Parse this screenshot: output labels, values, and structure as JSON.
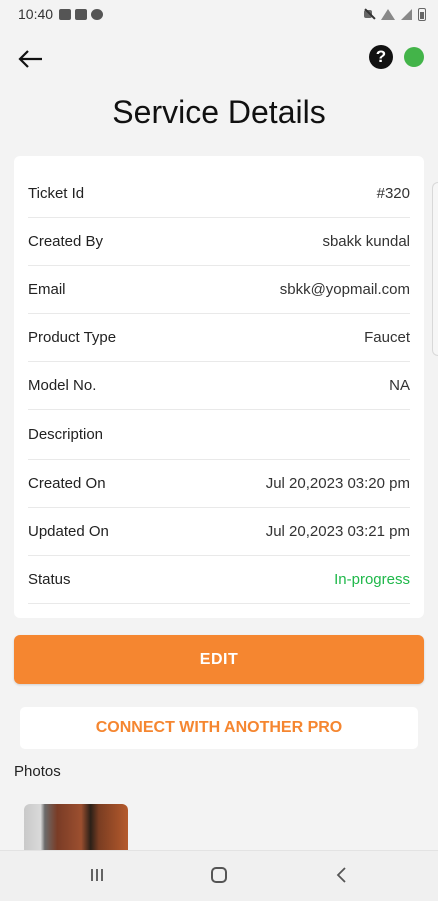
{
  "statusbar": {
    "time": "10:40"
  },
  "header": {
    "title": "Service Details"
  },
  "colors": {
    "accent": "#f58630",
    "status_green": "#1fb84a",
    "online_dot": "#43b449"
  },
  "details": [
    {
      "label": "Ticket Id",
      "value": "#320"
    },
    {
      "label": "Created By",
      "value": "sbakk kundal"
    },
    {
      "label": "Email",
      "value": "sbkk@yopmail.com"
    },
    {
      "label": "Product Type",
      "value": "Faucet"
    },
    {
      "label": "Model No.",
      "value": "NA"
    },
    {
      "label": "Description",
      "value": ""
    },
    {
      "label": "Created On",
      "value": "Jul 20,2023 03:20 pm"
    },
    {
      "label": "Updated On",
      "value": "Jul 20,2023 03:21 pm"
    },
    {
      "label": "Status",
      "value": "In-progress"
    }
  ],
  "actions": {
    "edit_label": "EDIT",
    "connect_label": "CONNECT WITH ANOTHER PRO"
  },
  "photos": {
    "label": "Photos"
  }
}
